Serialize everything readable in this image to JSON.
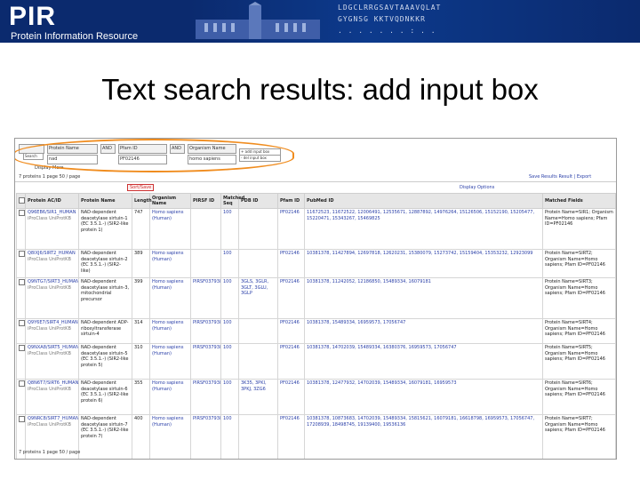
{
  "banner": {
    "logo": "PIR",
    "logo_sub": "Protein Information Resource",
    "seq_lines": [
      "LDGCLRRGSAVTAAAVQLAT",
      "GYGNSG  KKTVQDNKKR",
      ". . .    . . . . : . ."
    ]
  },
  "slide": {
    "title": "Text search results: add input box"
  },
  "search": {
    "row1": {
      "bool": "",
      "field": "Protein Name",
      "bool2": "AND",
      "field2": "Pfam ID",
      "bool3": "AND",
      "field3": "Organism Name"
    },
    "row2": {
      "value1": "nad",
      "value2": "PF02146",
      "value3": "homo sapiens"
    },
    "display_label": "Display More",
    "search_button": "Search",
    "add_input_button": "Add Input Box",
    "add_row_button": "+ add input box",
    "del_row_button": "- del input box"
  },
  "toolbar": {
    "left": "7 proteins   1 page   50 / page",
    "right": "Save Results    Result | Export",
    "sort_button": "Sort/Save",
    "sort_button2": "Display Options"
  },
  "columns": [
    "",
    "Protein AC/ID",
    "Protein Name",
    "Length",
    "Organism Name",
    "PIRSF ID",
    "Matched Seq",
    "PDB ID",
    "Pfam ID",
    "PubMed ID",
    "Matched Fields"
  ],
  "rows": [
    {
      "id": "Q96EB6/SIR1_HUMAN",
      "sub": "iProClass  UniProtKB",
      "name": "NAD-dependent deacetylase sirtuin-1 (EC 3.5.1.-) (SIR2-like protein 1)",
      "length": "747",
      "org": "Homo sapiens (Human)",
      "pirsf": "",
      "matched": "100",
      "pdb": "",
      "pfam": "PF02146",
      "pubmed": "11672523, 11672522, 12006491, 12535671, 12887892, 14976264, 15126506, 15152190, 15205477, 15220471, 15343267, 15469825",
      "fields": "Protein Name=SIR1; Organism Name=Homo sapiens; Pfam ID=PF02146"
    },
    {
      "id": "Q8IXJ6/SIRT2_HUMAN",
      "sub": "iProClass  UniProtKB",
      "name": "NAD-dependent deacetylase sirtuin-2 (EC 3.5.1.-) (SIR2-like)",
      "length": "389",
      "org": "Homo sapiens (Human)",
      "pirsf": "",
      "matched": "100",
      "pdb": "",
      "pfam": "PF02146",
      "pubmed": "10381378, 11427894, 12697818, 12620231, 15380079, 15273742, 15159404, 15353232, 12923099",
      "fields": "Protein Name=SIRT2; Organism Name=Homo sapiens; Pfam ID=PF02146"
    },
    {
      "id": "Q9NTG7/SIRT3_HUMAN",
      "sub": "iProClass  UniProtKB",
      "name": "NAD-dependent deacetylase sirtuin-3, mitochondrial precursor",
      "length": "399",
      "org": "Homo sapiens (Human)",
      "pirsf": "PIRSF037938",
      "matched": "100",
      "pdb": "3GLS, 3GLR, 3GLT, 3GLU, 3GLP",
      "pfam": "PF02146",
      "pubmed": "10381378, 11242052, 12186850, 15489334, 16079181",
      "fields": "Protein Name=SIRT3; Organism Name=Homo sapiens; Pfam ID=PF02146"
    },
    {
      "id": "Q9Y6E7/SIRT4_HUMAN",
      "sub": "iProClass  UniProtKB",
      "name": "NAD-dependent ADP-ribosyltransferase sirtuin-4",
      "length": "314",
      "org": "Homo sapiens (Human)",
      "pirsf": "PIRSF037938",
      "matched": "100",
      "pdb": "",
      "pfam": "PF02146",
      "pubmed": "10381378, 15489334, 16959573, 17056747",
      "fields": "Protein Name=SIRT4; Organism Name=Homo sapiens; Pfam ID=PF02146"
    },
    {
      "id": "Q9NXA8/SIRT5_HUMAN",
      "sub": "iProClass  UniProtKB",
      "name": "NAD-dependent deacetylase sirtuin-5 (EC 3.5.1.-) (SIR2-like protein 5)",
      "length": "310",
      "org": "Homo sapiens (Human)",
      "pirsf": "PIRSF037938",
      "matched": "100",
      "pdb": "",
      "pfam": "PF02146",
      "pubmed": "10381378, 14702039, 15489334, 16380376, 16959573, 17056747",
      "fields": "Protein Name=SIRT5; Organism Name=Homo sapiens; Pfam ID=PF02146"
    },
    {
      "id": "Q8N6T7/SIRT6_HUMAN",
      "sub": "iProClass  UniProtKB",
      "name": "NAD-dependent deacetylase sirtuin-6 (EC 3.5.1.-) (SIR2-like protein 6)",
      "length": "355",
      "org": "Homo sapiens (Human)",
      "pirsf": "PIRSF037938",
      "matched": "100",
      "pdb": "3K35, 3PKI, 3PKJ, 3ZG6",
      "pfam": "PF02146",
      "pubmed": "10381378, 12477932, 14702039, 15489334, 16079181, 16959573",
      "fields": "Protein Name=SIRT6; Organism Name=Homo sapiens; Pfam ID=PF02146"
    },
    {
      "id": "Q9NRC8/SIRT7_HUMAN",
      "sub": "iProClass  UniProtKB",
      "name": "NAD-dependent deacetylase sirtuin-7 (EC 3.5.1.-) (SIR2-like protein 7)",
      "length": "400",
      "org": "Homo sapiens (Human)",
      "pirsf": "PIRSF037938",
      "matched": "100",
      "pdb": "",
      "pfam": "PF02146",
      "pubmed": "10381378, 10873683, 14702039, 15489334, 15815621, 16079181, 16618798, 16959573, 17056747, 17208939, 18498745, 19139400, 19536136",
      "fields": "Protein Name=SIRT7; Organism Name=Homo sapiens; Pfam ID=PF02146"
    }
  ],
  "footer": {
    "text": "7 proteins   1 page   50 / page"
  },
  "colors": {
    "banner": "#0b2a6e",
    "oval": "#f08c1e",
    "link": "#2a3fa8"
  }
}
